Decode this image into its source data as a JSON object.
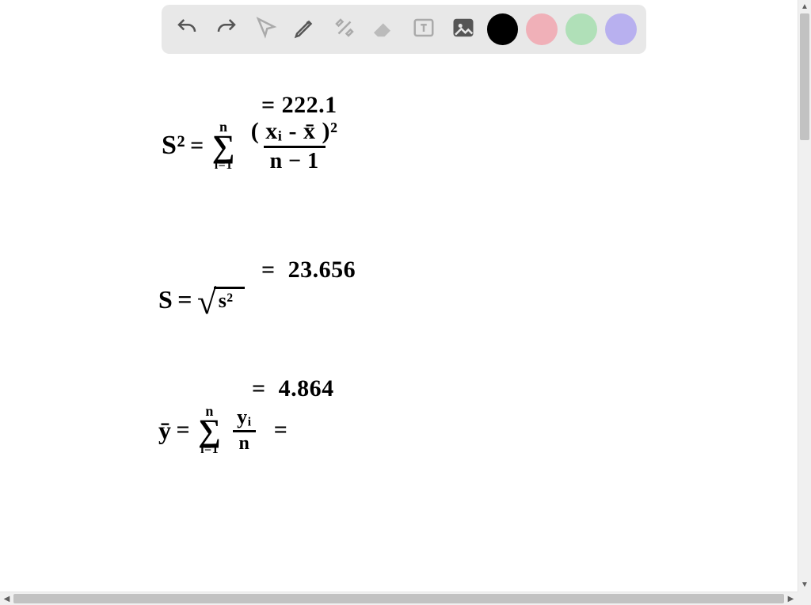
{
  "toolbar": {
    "tools": {
      "undo": "undo-icon",
      "redo": "redo-icon",
      "pointer": "pointer-icon",
      "pencil": "pencil-icon",
      "tools_menu": "tools-icon",
      "eraser": "eraser-icon",
      "text": "text-icon",
      "image": "image-icon"
    },
    "colors": {
      "black": "#000000",
      "pink": "#f0b0b8",
      "green": "#b0e0b8",
      "violet": "#b8b0ef",
      "selected": "black"
    }
  },
  "notes": {
    "line1_prefix": "=",
    "line1_value": "222.1",
    "s2_lhs": "S²",
    "eq": "=",
    "sum_upper": "n",
    "sum_lower": "i=1",
    "frac1_num": "( xᵢ - x̄ )²",
    "frac1_den": "n − 1",
    "s2_value": "23.656",
    "s_lhs": "S",
    "sqrt_radicand": "s²",
    "s_value": "4.864",
    "ybar_lhs": "ȳ",
    "frac2_num": "yᵢ",
    "frac2_den": "n",
    "ybar_trailing": ""
  }
}
